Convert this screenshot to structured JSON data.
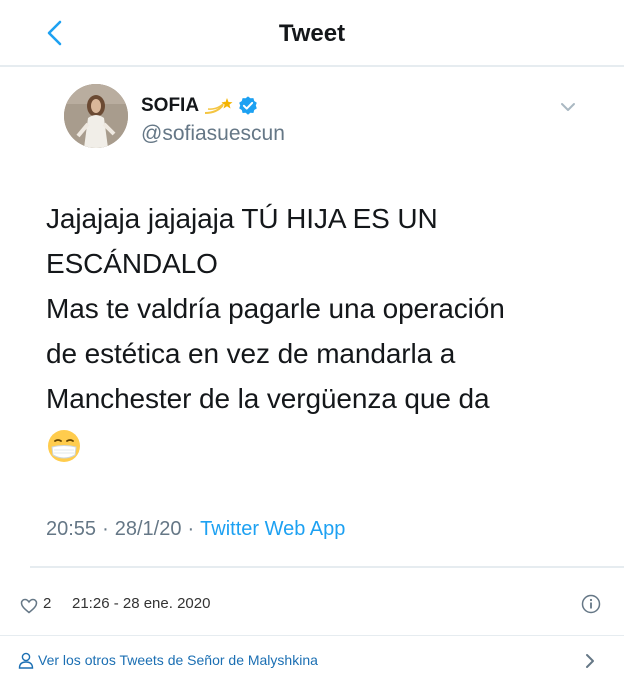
{
  "header": {
    "title": "Tweet",
    "back_icon": "chevron-left-icon"
  },
  "author": {
    "name": "SOFIA",
    "name_emoji": "dizzy-emoji",
    "verified_icon": "verified-badge-icon",
    "handle": "@sofiasuescun"
  },
  "tweet": {
    "text_lines": [
      "Jajajaja jajajaja TÚ HIJA ES UN",
      "ESCÁNDALO",
      "Mas te valdría pagarle una operación",
      "de estética en vez de mandarla a",
      "Manchester de la vergüenza que da"
    ],
    "emoji": "mask-face-emoji",
    "time": "20:55",
    "date": "28/1/20",
    "separator": "·",
    "source": "Twitter Web App"
  },
  "embed_footer": {
    "like_count": "2",
    "datetime": "21:26 - 28 ene. 2020",
    "more_tweets_label": "Ver los otros Tweets de Señor de Malyshkina"
  },
  "colors": {
    "accent": "#1da1f2",
    "link": "#1b6fb3",
    "secondary_text": "#657786",
    "divider": "#e6ecf0"
  }
}
